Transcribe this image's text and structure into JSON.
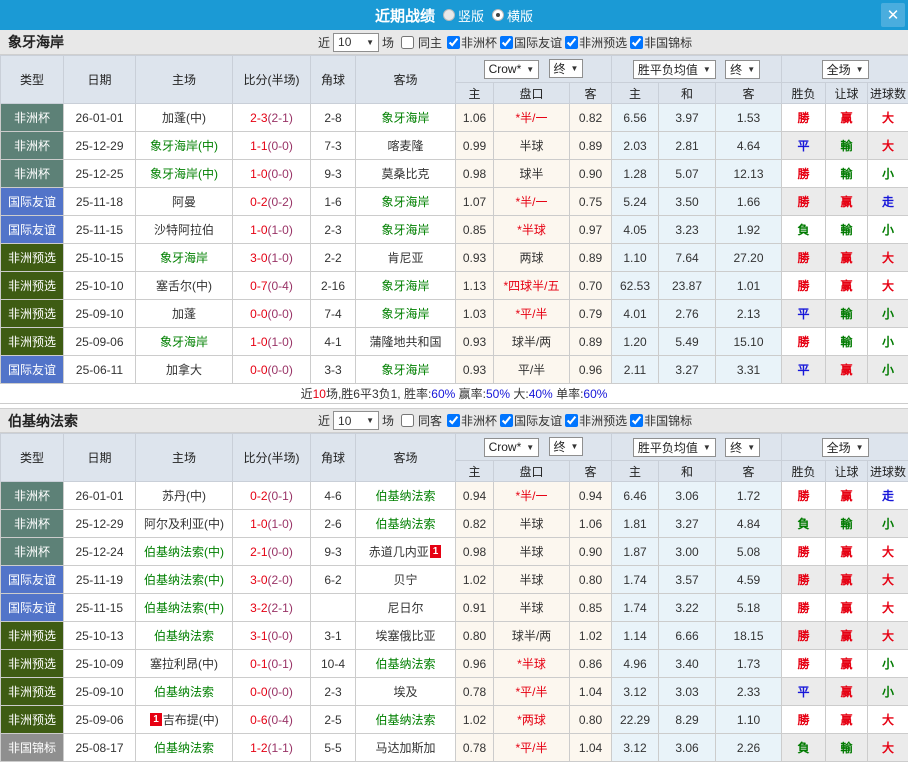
{
  "titlebar": {
    "title": "近期战绩",
    "vertical": "竖版",
    "horizontal": "横版",
    "close": "✕"
  },
  "table_header": {
    "cols": [
      "类型",
      "日期",
      "主场",
      "比分(半场)",
      "角球",
      "客场"
    ],
    "group1": {
      "select1": "Crow*",
      "select2": "终",
      "subs": [
        "主",
        "盘口",
        "客"
      ]
    },
    "group2": {
      "select1": "胜平负均值",
      "select2": "终",
      "subs": [
        "主",
        "和",
        "客"
      ]
    },
    "group3": {
      "select": "全场",
      "subs": [
        "胜负",
        "让球",
        "进球数"
      ]
    }
  },
  "colors": {
    "type": {
      "非洲杯": "#5d8177",
      "国际友谊": "#5274c9",
      "非洲预选": "#3e5c13",
      "非国锦标": "#8f8f8f"
    },
    "result_map": {
      "勝": "red",
      "負": "green",
      "平": "blue",
      "赢": "red",
      "輸": "green",
      "走": "blue",
      "大": "red",
      "小": "green"
    }
  },
  "sections": [
    {
      "team": "象牙海岸",
      "filter": {
        "near": "近",
        "count": "10",
        "games": "场",
        "same": "同主",
        "same_checked": false,
        "comps": [
          {
            "label": "非洲杯",
            "checked": true
          },
          {
            "label": "国际友谊",
            "checked": true
          },
          {
            "label": "非洲预选",
            "checked": true
          },
          {
            "label": "非国锦标",
            "checked": true
          }
        ]
      },
      "rows": [
        {
          "type": "非洲杯",
          "date": "26-01-01",
          "home": "加蓬(中)",
          "home_green": false,
          "score": "2-3",
          "half": "(2-1)",
          "corner": "2-8",
          "away": "象牙海岸",
          "away_green": true,
          "crow": [
            "1.06",
            "*半/一",
            "0.82"
          ],
          "avg": [
            "6.56",
            "3.97",
            "1.53"
          ],
          "res": [
            "勝",
            "赢",
            "大"
          ]
        },
        {
          "type": "非洲杯",
          "date": "25-12-29",
          "home": "象牙海岸(中)",
          "home_green": true,
          "score": "1-1",
          "half": "(0-0)",
          "corner": "7-3",
          "away": "喀麦隆",
          "away_green": false,
          "crow": [
            "0.99",
            "半球",
            "0.89"
          ],
          "avg": [
            "2.03",
            "2.81",
            "4.64"
          ],
          "res": [
            "平",
            "輸",
            "大"
          ]
        },
        {
          "type": "非洲杯",
          "date": "25-12-25",
          "home": "象牙海岸(中)",
          "home_green": true,
          "score": "1-0",
          "half": "(0-0)",
          "corner": "9-3",
          "away": "莫桑比克",
          "away_green": false,
          "crow": [
            "0.98",
            "球半",
            "0.90"
          ],
          "avg": [
            "1.28",
            "5.07",
            "12.13"
          ],
          "res": [
            "勝",
            "輸",
            "小"
          ]
        },
        {
          "type": "国际友谊",
          "date": "25-11-18",
          "home": "阿曼",
          "home_green": false,
          "score": "0-2",
          "half": "(0-2)",
          "corner": "1-6",
          "away": "象牙海岸",
          "away_green": true,
          "crow": [
            "1.07",
            "*半/一",
            "0.75"
          ],
          "avg": [
            "5.24",
            "3.50",
            "1.66"
          ],
          "res": [
            "勝",
            "赢",
            "走"
          ]
        },
        {
          "type": "国际友谊",
          "date": "25-11-15",
          "home": "沙特阿拉伯",
          "home_green": false,
          "score": "1-0",
          "half": "(1-0)",
          "corner": "2-3",
          "away": "象牙海岸",
          "away_green": true,
          "crow": [
            "0.85",
            "*半球",
            "0.97"
          ],
          "avg": [
            "4.05",
            "3.23",
            "1.92"
          ],
          "res": [
            "負",
            "輸",
            "小"
          ]
        },
        {
          "type": "非洲预选",
          "date": "25-10-15",
          "home": "象牙海岸",
          "home_green": true,
          "score": "3-0",
          "half": "(1-0)",
          "corner": "2-2",
          "away": "肯尼亚",
          "away_green": false,
          "crow": [
            "0.93",
            "两球",
            "0.89"
          ],
          "avg": [
            "1.10",
            "7.64",
            "27.20"
          ],
          "res": [
            "勝",
            "赢",
            "大"
          ]
        },
        {
          "type": "非洲预选",
          "date": "25-10-10",
          "home": "塞舌尔(中)",
          "home_green": false,
          "score": "0-7",
          "half": "(0-4)",
          "corner": "2-16",
          "away": "象牙海岸",
          "away_green": true,
          "crow": [
            "1.13",
            "*四球半/五",
            "0.70"
          ],
          "avg": [
            "62.53",
            "23.87",
            "1.01"
          ],
          "res": [
            "勝",
            "赢",
            "大"
          ]
        },
        {
          "type": "非洲预选",
          "date": "25-09-10",
          "home": "加蓬",
          "home_green": false,
          "score": "0-0",
          "half": "(0-0)",
          "corner": "7-4",
          "away": "象牙海岸",
          "away_green": true,
          "crow": [
            "1.03",
            "*平/半",
            "0.79"
          ],
          "avg": [
            "4.01",
            "2.76",
            "2.13"
          ],
          "res": [
            "平",
            "輸",
            "小"
          ]
        },
        {
          "type": "非洲预选",
          "date": "25-09-06",
          "home": "象牙海岸",
          "home_green": true,
          "score": "1-0",
          "half": "(1-0)",
          "corner": "4-1",
          "away": "蒲隆地共和国",
          "away_green": false,
          "crow": [
            "0.93",
            "球半/两",
            "0.89"
          ],
          "avg": [
            "1.20",
            "5.49",
            "15.10"
          ],
          "res": [
            "勝",
            "輸",
            "小"
          ]
        },
        {
          "type": "国际友谊",
          "date": "25-06-11",
          "home": "加拿大",
          "home_green": false,
          "score": "0-0",
          "half": "(0-0)",
          "corner": "3-3",
          "away": "象牙海岸",
          "away_green": true,
          "crow": [
            "0.93",
            "平/半",
            "0.96"
          ],
          "avg": [
            "2.11",
            "3.27",
            "3.31"
          ],
          "res": [
            "平",
            "赢",
            "小"
          ]
        }
      ],
      "summary": [
        {
          "t": "近",
          "c": "black"
        },
        {
          "t": "10",
          "c": "red"
        },
        {
          "t": "场,胜6平3负1, 胜率:",
          "c": "black"
        },
        {
          "t": "60%",
          "c": "blue"
        },
        {
          "t": " 赢率:",
          "c": "black"
        },
        {
          "t": "50%",
          "c": "blue"
        },
        {
          "t": " 大:",
          "c": "black"
        },
        {
          "t": "40%",
          "c": "blue"
        },
        {
          "t": " 单率:",
          "c": "black"
        },
        {
          "t": "60%",
          "c": "blue"
        }
      ]
    },
    {
      "team": "伯基纳法索",
      "filter": {
        "near": "近",
        "count": "10",
        "games": "场",
        "same": "同客",
        "same_checked": false,
        "comps": [
          {
            "label": "非洲杯",
            "checked": true
          },
          {
            "label": "国际友谊",
            "checked": true
          },
          {
            "label": "非洲预选",
            "checked": true
          },
          {
            "label": "非国锦标",
            "checked": true
          }
        ]
      },
      "rows": [
        {
          "type": "非洲杯",
          "date": "26-01-01",
          "home": "苏丹(中)",
          "home_green": false,
          "score": "0-2",
          "half": "(0-1)",
          "corner": "4-6",
          "away": "伯基纳法索",
          "away_green": true,
          "crow": [
            "0.94",
            "*半/一",
            "0.94"
          ],
          "avg": [
            "6.46",
            "3.06",
            "1.72"
          ],
          "res": [
            "勝",
            "赢",
            "走"
          ]
        },
        {
          "type": "非洲杯",
          "date": "25-12-29",
          "home": "阿尔及利亚(中)",
          "home_green": false,
          "score": "1-0",
          "half": "(1-0)",
          "corner": "2-6",
          "away": "伯基纳法索",
          "away_green": true,
          "crow": [
            "0.82",
            "半球",
            "1.06"
          ],
          "avg": [
            "1.81",
            "3.27",
            "4.84"
          ],
          "res": [
            "負",
            "輸",
            "小"
          ]
        },
        {
          "type": "非洲杯",
          "date": "25-12-24",
          "home": "伯基纳法索(中)",
          "home_green": true,
          "score": "2-1",
          "half": "(0-0)",
          "corner": "9-3",
          "away": "赤道几内亚",
          "away_green": false,
          "away_badge_after": "1",
          "crow": [
            "0.98",
            "半球",
            "0.90"
          ],
          "avg": [
            "1.87",
            "3.00",
            "5.08"
          ],
          "res": [
            "勝",
            "赢",
            "大"
          ]
        },
        {
          "type": "国际友谊",
          "date": "25-11-19",
          "home": "伯基纳法索(中)",
          "home_green": true,
          "score": "3-0",
          "half": "(2-0)",
          "corner": "6-2",
          "away": "贝宁",
          "away_green": false,
          "crow": [
            "1.02",
            "半球",
            "0.80"
          ],
          "avg": [
            "1.74",
            "3.57",
            "4.59"
          ],
          "res": [
            "勝",
            "赢",
            "大"
          ]
        },
        {
          "type": "国际友谊",
          "date": "25-11-15",
          "home": "伯基纳法索(中)",
          "home_green": true,
          "score": "3-2",
          "half": "(2-1)",
          "corner": "",
          "away": "尼日尔",
          "away_green": false,
          "crow": [
            "0.91",
            "半球",
            "0.85"
          ],
          "avg": [
            "1.74",
            "3.22",
            "5.18"
          ],
          "res": [
            "勝",
            "赢",
            "大"
          ]
        },
        {
          "type": "非洲预选",
          "date": "25-10-13",
          "home": "伯基纳法索",
          "home_green": true,
          "score": "3-1",
          "half": "(0-0)",
          "corner": "3-1",
          "away": "埃塞俄比亚",
          "away_green": false,
          "crow": [
            "0.80",
            "球半/两",
            "1.02"
          ],
          "avg": [
            "1.14",
            "6.66",
            "18.15"
          ],
          "res": [
            "勝",
            "赢",
            "大"
          ]
        },
        {
          "type": "非洲预选",
          "date": "25-10-09",
          "home": "塞拉利昂(中)",
          "home_green": false,
          "score": "0-1",
          "half": "(0-1)",
          "corner": "10-4",
          "away": "伯基纳法索",
          "away_green": true,
          "crow": [
            "0.96",
            "*半球",
            "0.86"
          ],
          "avg": [
            "4.96",
            "3.40",
            "1.73"
          ],
          "res": [
            "勝",
            "赢",
            "小"
          ]
        },
        {
          "type": "非洲预选",
          "date": "25-09-10",
          "home": "伯基纳法索",
          "home_green": true,
          "score": "0-0",
          "half": "(0-0)",
          "corner": "2-3",
          "away": "埃及",
          "away_green": false,
          "crow": [
            "0.78",
            "*平/半",
            "1.04"
          ],
          "avg": [
            "3.12",
            "3.03",
            "2.33"
          ],
          "res": [
            "平",
            "赢",
            "小"
          ]
        },
        {
          "type": "非洲预选",
          "date": "25-09-06",
          "home": "吉布提(中)",
          "home_green": false,
          "home_badge_before": "1",
          "score": "0-6",
          "half": "(0-4)",
          "corner": "2-5",
          "away": "伯基纳法索",
          "away_green": true,
          "crow": [
            "1.02",
            "*两球",
            "0.80"
          ],
          "avg": [
            "22.29",
            "8.29",
            "1.10"
          ],
          "res": [
            "勝",
            "赢",
            "大"
          ]
        },
        {
          "type": "非国锦标",
          "date": "25-08-17",
          "home": "伯基纳法索",
          "home_green": true,
          "score": "1-2",
          "half": "(1-1)",
          "corner": "5-5",
          "away": "马达加斯加",
          "away_green": false,
          "crow": [
            "0.78",
            "*平/半",
            "1.04"
          ],
          "avg": [
            "3.12",
            "3.06",
            "2.26"
          ],
          "res": [
            "負",
            "輸",
            "大"
          ]
        }
      ]
    }
  ]
}
